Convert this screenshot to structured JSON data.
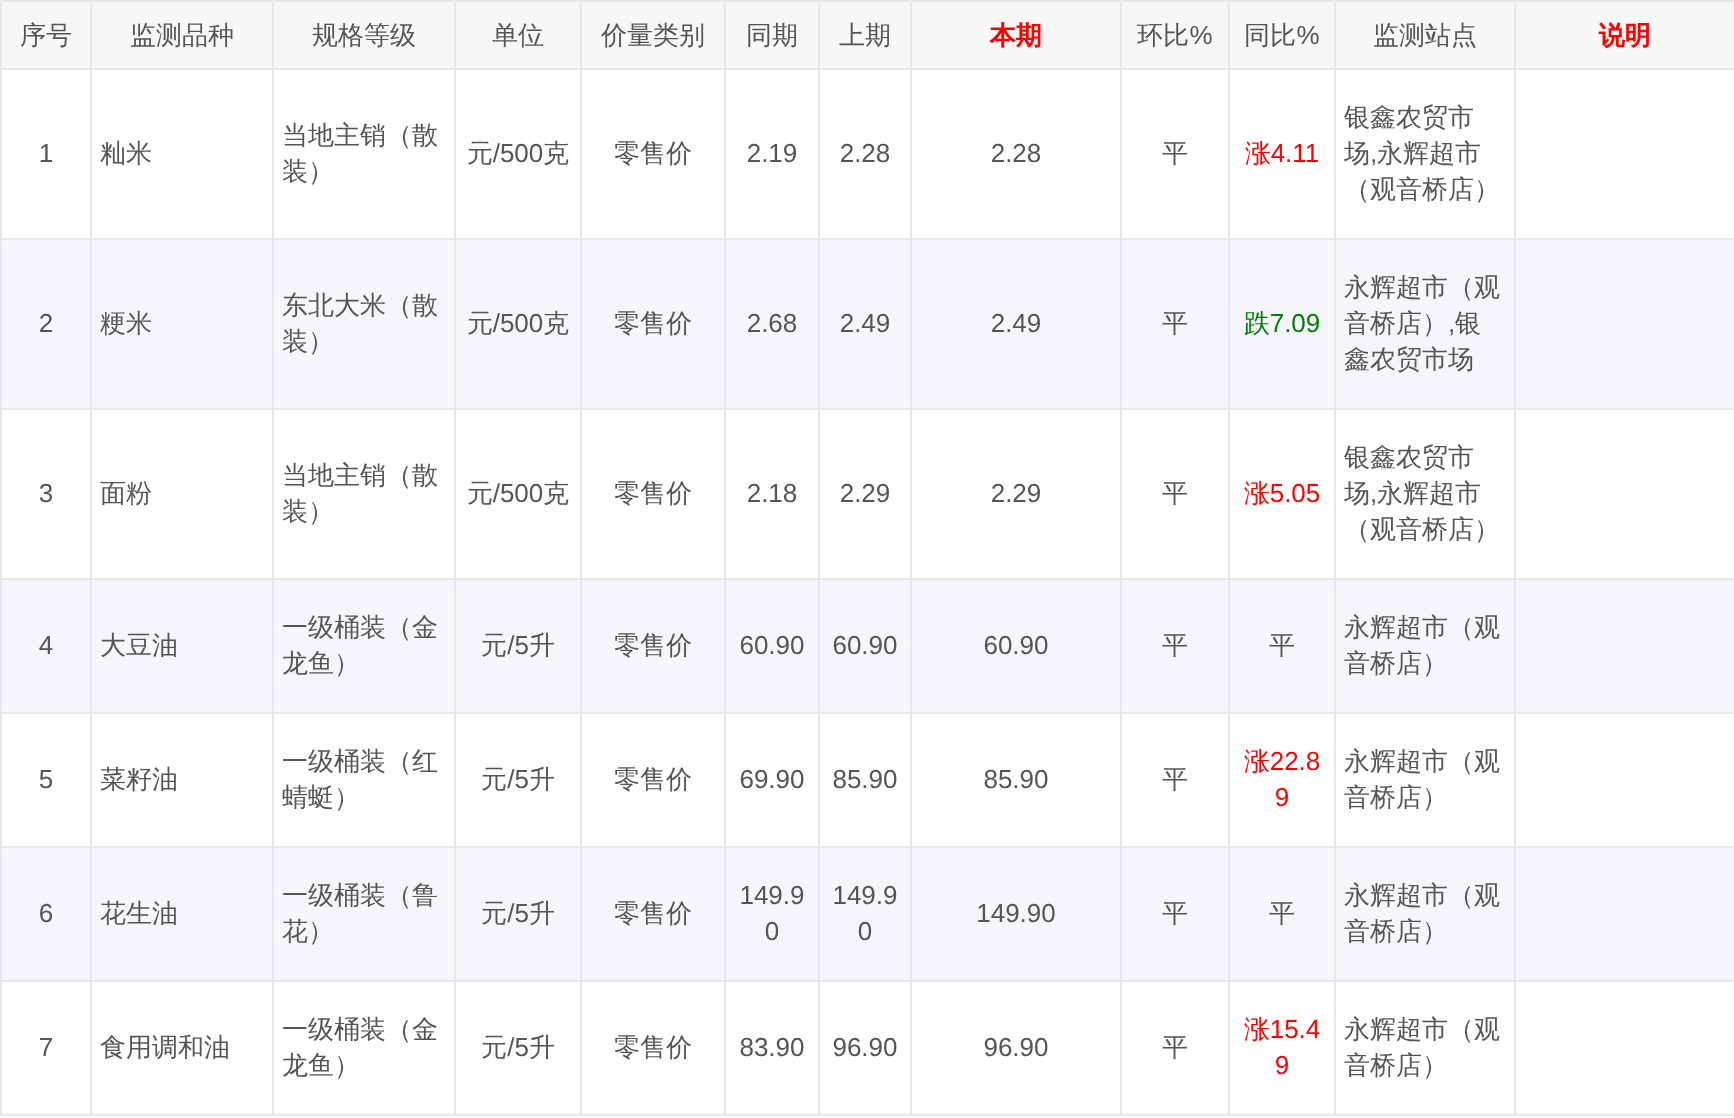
{
  "table": {
    "columns": [
      {
        "label": "序号",
        "highlight": false
      },
      {
        "label": "监测品种",
        "highlight": false
      },
      {
        "label": "规格等级",
        "highlight": false
      },
      {
        "label": "单位",
        "highlight": false
      },
      {
        "label": "价量类别",
        "highlight": false
      },
      {
        "label": "同期",
        "highlight": false
      },
      {
        "label": "上期",
        "highlight": false
      },
      {
        "label": "本期",
        "highlight": true
      },
      {
        "label": "环比%",
        "highlight": false
      },
      {
        "label": "同比%",
        "highlight": false
      },
      {
        "label": "监测站点",
        "highlight": false
      },
      {
        "label": "说明",
        "highlight": true
      }
    ],
    "rows": [
      {
        "no": "1",
        "item": "籼米",
        "spec": "当地主销（散装）",
        "unit": "元/500克",
        "category": "零售价",
        "same_period": "2.19",
        "last_period": "2.28",
        "current": "2.28",
        "mom": "平",
        "yoy": "涨4.11",
        "color": "#ff0000",
        "stations": "银鑫农贸市场,永辉超市（观音桥店）"
      },
      {
        "no": "2",
        "item": "粳米",
        "spec": "东北大米（散装）",
        "unit": "元/500克",
        "category": "零售价",
        "same_period": "2.68",
        "last_period": "2.49",
        "current": "2.49",
        "mom": "平",
        "yoy": "跌7.09",
        "color": "#008000",
        "stations": "永辉超市（观音桥店）,银鑫农贸市场"
      },
      {
        "no": "3",
        "item": "面粉",
        "spec": "当地主销（散装）",
        "unit": "元/500克",
        "category": "零售价",
        "same_period": "2.18",
        "last_period": "2.29",
        "current": "2.29",
        "mom": "平",
        "yoy": "涨5.05",
        "color": "#ff0000",
        "stations": "银鑫农贸市场,永辉超市（观音桥店）"
      },
      {
        "no": "4",
        "item": "大豆油",
        "spec": "一级桶装（金龙鱼）",
        "unit": "元/5升",
        "category": "零售价",
        "same_period": "60.90",
        "last_period": "60.90",
        "current": "60.90",
        "mom": "平",
        "yoy": "平",
        "color": "#555555",
        "stations": "永辉超市（观音桥店）"
      },
      {
        "no": "5",
        "item": "菜籽油",
        "spec": "一级桶装（红蜻蜓）",
        "unit": "元/5升",
        "category": "零售价",
        "same_period": "69.90",
        "last_period": "85.90",
        "current": "85.90",
        "mom": "平",
        "yoy": "涨22.89",
        "color": "#ff0000",
        "stations": "永辉超市（观音桥店）"
      },
      {
        "no": "6",
        "item": "花生油",
        "spec": "一级桶装（鲁花）",
        "unit": "元/5升",
        "category": "零售价",
        "same_period": "149.90",
        "last_period": "149.90",
        "current": "149.90",
        "mom": "平",
        "yoy": "平",
        "color": "#555555",
        "stations": "永辉超市（观音桥店）"
      },
      {
        "no": "7",
        "item": "食用调和油",
        "spec": "一级桶装（金龙鱼）",
        "unit": "元/5升",
        "category": "零售价",
        "same_period": "83.90",
        "last_period": "96.90",
        "current": "96.90",
        "mom": "平",
        "yoy": "涨15.49",
        "color": "#ff0000",
        "stations": "永辉超市（观音桥店）"
      }
    ]
  }
}
